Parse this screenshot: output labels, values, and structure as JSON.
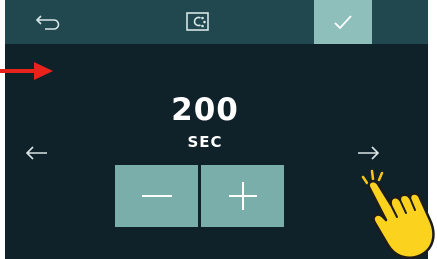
{
  "header": {
    "back_icon": "return-arrow-icon",
    "mode_icon": "program-mode-icon",
    "confirm_icon": "checkmark-icon"
  },
  "setting": {
    "value": "200",
    "unit": "SEC"
  },
  "controls": {
    "decrease_icon": "minus-icon",
    "increase_icon": "plus-icon",
    "prev_icon": "arrow-left-icon",
    "next_icon": "arrow-right-icon"
  },
  "annotations": {
    "pointer_arrow_icon": "red-arrow-icon",
    "hand_icon": "tapping-hand-icon",
    "arrow_color": "#e8231c",
    "hand_color": "#f7c41a"
  },
  "colors": {
    "screen_bg": "#0f2129",
    "topbar_bg": "#20484e",
    "confirm_bg": "#8fbfbb",
    "button_bg": "#7aaeaa"
  }
}
